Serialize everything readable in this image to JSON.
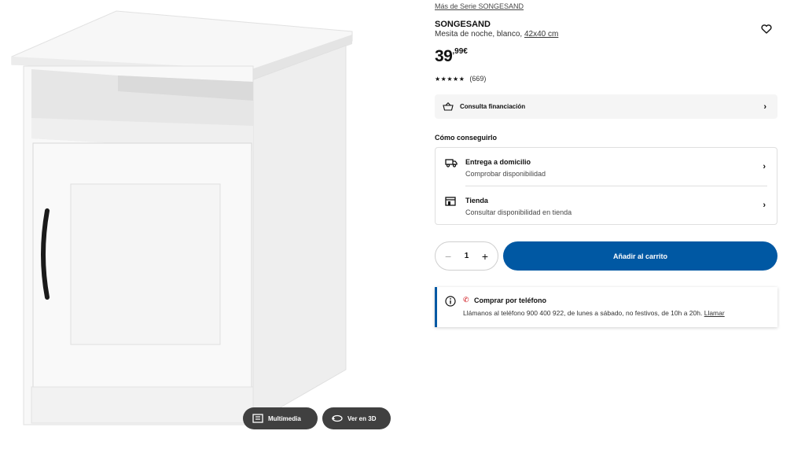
{
  "media": {
    "multimedia_label": "Multimedia",
    "view3d_label": "Ver en 3D"
  },
  "product": {
    "series_link": "Más de Serie SONGESAND",
    "name": "SONGESAND",
    "description": "Mesita de noche, blanco,",
    "measure": "42x40 cm",
    "price_int": "39",
    "price_dec": ",99€",
    "stars": "★★★★★",
    "reviews": "(669)"
  },
  "finance": {
    "label": "Consulta financiación"
  },
  "how": {
    "title": "Cómo conseguirlo",
    "options": [
      {
        "title": "Entrega a domicilio",
        "subtitle": "Comprobar disponibilidad",
        "icon": "truck-icon"
      },
      {
        "title": "Tienda",
        "subtitle": "Consultar disponibilidad en tienda",
        "icon": "store-icon"
      }
    ]
  },
  "cart": {
    "minus": "−",
    "quantity": "1",
    "plus": "+",
    "add_label": "Añadir al carrito"
  },
  "phone": {
    "title": "Comprar por teléfono",
    "text": "Llámanos al teléfono 900 400 922, de lunes a sábado, no festivos, de 10h a 20h.",
    "call_link": "Llamar"
  },
  "colors": {
    "accent": "#0058a3",
    "phone_icon": "#cc0008"
  }
}
